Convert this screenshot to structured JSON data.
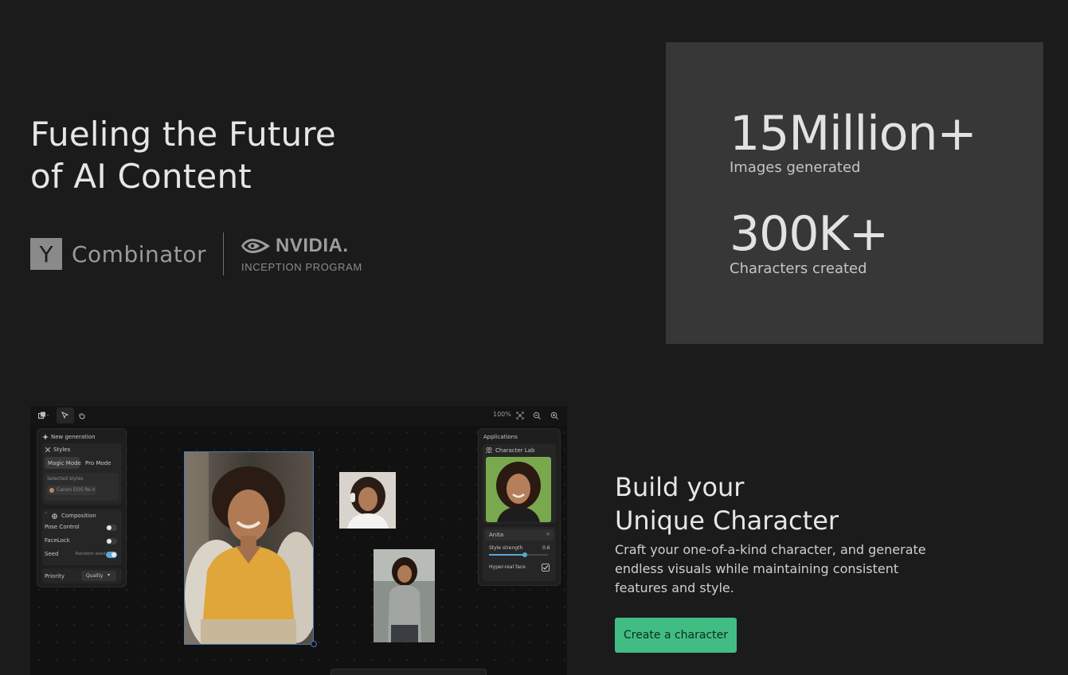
{
  "hero": {
    "title_line1": "Fueling the Future",
    "title_line2": "of AI Content"
  },
  "partners": {
    "yc_letter": "Y",
    "yc_name": "Combinator",
    "nvidia_name": "NVIDIA.",
    "nvidia_program": "INCEPTION PROGRAM"
  },
  "stats": [
    {
      "value": "15Million+",
      "label": "Images generated"
    },
    {
      "value": "300K+",
      "label": "Characters created"
    }
  ],
  "mockup": {
    "zoom": "100%",
    "left_panel": {
      "title": "New generation",
      "styles_label": "Styles",
      "magic_mode": "Magic Mode",
      "pro_mode": "Pro Mode",
      "selected_styles_label": "Selected styles",
      "selected_style_chip": "Canon EOS Re",
      "composition_label": "Composition",
      "pose_control": "Pose Control",
      "facelock": "FaceLock",
      "seed": "Seed",
      "random_seed": "Random seed",
      "priority": "Priority",
      "priority_value": "Quality"
    },
    "right_panel": {
      "title": "Applications",
      "character_lab": "Character Lab",
      "character_name": "Anita",
      "style_strength_label": "Style strength",
      "style_strength_value": "0.6",
      "hyper_real_face": "Hyper-real face"
    }
  },
  "build": {
    "title_line1": "Build your",
    "title_line2": "Unique Character",
    "description": "Craft your one-of-a-kind character, and generate endless visuals while maintaining consistent features and style.",
    "cta_label": "Create a character"
  },
  "colors": {
    "background": "#1b1b1b",
    "stats_panel": "#373737",
    "cta": "#41bd84",
    "toggle_on": "#5aa7d9"
  },
  "icons": [
    "y-combinator-logo",
    "nvidia-eye-icon",
    "layers-icon",
    "cursor-icon",
    "hand-icon",
    "fit-icon",
    "zoom-out-icon",
    "zoom-in-icon",
    "sparkle-icon",
    "composition-icon",
    "close-icon",
    "checkbox-icon"
  ]
}
